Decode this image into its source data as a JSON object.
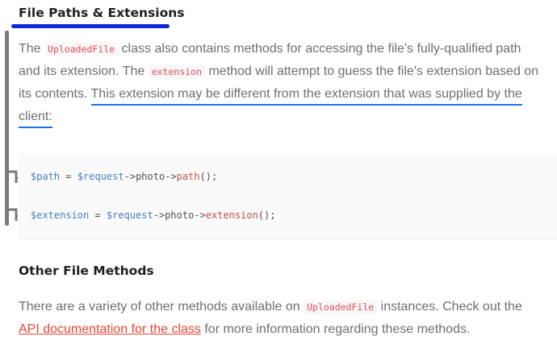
{
  "section1": {
    "title": "File Paths & Extensions",
    "paragraph": {
      "t1": "The ",
      "code1": "UploadedFile",
      "t2": " class also contains methods for accessing the file's fully-qualified path and its extension. The ",
      "code2": "extension",
      "t3": " method will attempt to guess the file's extension based on its contents. ",
      "highlight": "This extension may be different from the extension that was supplied by the client:"
    },
    "code": {
      "line1": {
        "var": "$path",
        "eq": " = ",
        "obj": "$request",
        "arrow1": "->",
        "prop": "photo",
        "arrow2": "->",
        "method": "path",
        "tail": "();"
      },
      "line2": {
        "var": "$extension",
        "eq": " = ",
        "obj": "$request",
        "arrow1": "->",
        "prop": "photo",
        "arrow2": "->",
        "method": "extension",
        "tail": "();"
      }
    }
  },
  "section2": {
    "title": "Other File Methods",
    "paragraph": {
      "t1": "There are a variety of other methods available on ",
      "code1": "UploadedFile",
      "t2": " instances. Check out the ",
      "link": "API documentation for the class",
      "t3": " for more information regarding these methods."
    }
  },
  "colors": {
    "annotation_underline": "#0a28d8",
    "highlight_underline": "#1a73e8",
    "inline_code": "#e44c58",
    "link": "#eb4432",
    "bracket": "#7a7a7a"
  }
}
